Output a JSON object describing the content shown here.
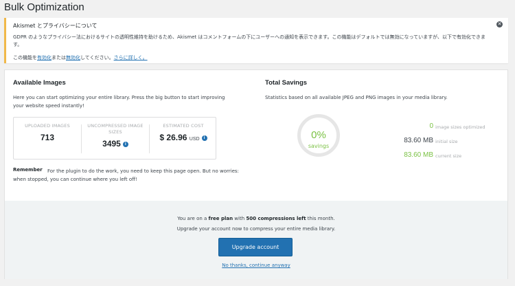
{
  "page": {
    "title": "Bulk Optimization"
  },
  "notice": {
    "title": "Akismet とプライバシーについて",
    "body": "GDPR のようなプライバシー法におけるサイトの透明性維持を助けるため、Akismet はコメントフォームの下にユーザーへの通知を表示できます。この機能はデフォルトでは無効になっていますが、以下で有効化できます。",
    "links_prefix": "この機能を",
    "enable_link": "有効化",
    "links_mid": "または",
    "disable_link": "無効化",
    "links_suffix": "してください。",
    "learn_more_link": "さらに詳しく。",
    "dismiss_icon": "close-circle-icon"
  },
  "available": {
    "title": "Available Images",
    "description": "Here you can start optimizing your entire library. Press the big button to start improving your website speed instantly!",
    "stats": [
      {
        "label": "UPLOADED IMAGES",
        "value": "713",
        "unit": ""
      },
      {
        "label": "UNCOMPRESSED IMAGE SIZES",
        "value": "3495",
        "unit": ""
      },
      {
        "label": "ESTIMATED COST",
        "value": "$ 26.96",
        "unit": "USD"
      }
    ],
    "remember_label": "Remember",
    "remember_text": "For the plugin to do the work, you need to keep this page open. But no worries: when stopped, you can continue where you left off!"
  },
  "savings": {
    "title": "Total Savings",
    "description": "Statistics based on all available JPEG and PNG images in your media library.",
    "percent": "0%",
    "percent_label": "savings",
    "rows": [
      {
        "value": "0",
        "label": "image sizes optimized",
        "color": "#7ac143"
      },
      {
        "value": "83.60 MB",
        "label": "initial size",
        "color": "#3c434a"
      },
      {
        "value": "83.60 MB",
        "label": "current size",
        "color": "#7ac143"
      }
    ]
  },
  "plan": {
    "prefix": "You are on a ",
    "plan_name": "free plan",
    "mid": " with ",
    "compressions": "500 compressions left",
    "suffix": " this month.",
    "upgrade_text": "Upgrade your account now to compress your entire media library.",
    "upgrade_button": "Upgrade account",
    "no_thanks": "No thanks, continue anyway"
  },
  "colors": {
    "accent": "#2271b1",
    "green": "#7ac143",
    "notice_border": "#f0b849"
  }
}
